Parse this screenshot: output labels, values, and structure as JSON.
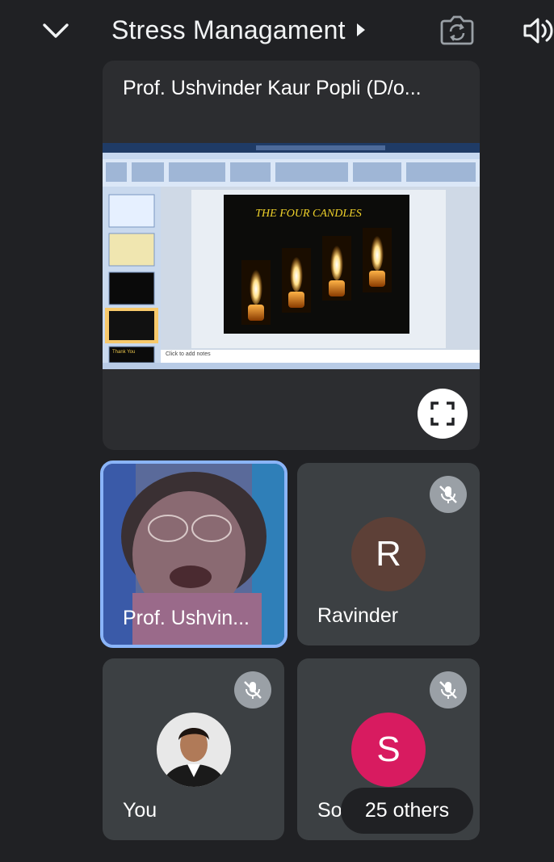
{
  "header": {
    "meeting_title": "Stress Managament",
    "collapse_icon": "chevron-down-icon",
    "switch_camera_icon": "camera-switch-icon",
    "audio_icon": "speaker-icon"
  },
  "presentation": {
    "presenter_label": "Prof. Ushvinder Kaur Popli (D/o...",
    "slide_title": "THE FOUR CANDLES",
    "notes_placeholder": "Click to add notes",
    "slide_thumbnail_text": "Thank You",
    "fullscreen_icon": "fullscreen-icon"
  },
  "participants": [
    {
      "name": "Prof. Ushvin...",
      "type": "video",
      "muted": false,
      "active_speaker": true
    },
    {
      "name": "Ravinder",
      "initial": "R",
      "avatar_color": "#5d4037",
      "muted": true
    },
    {
      "name": "You",
      "type": "photo",
      "muted": true
    },
    {
      "name": "So",
      "initial": "S",
      "avatar_color": "#d81b60",
      "muted": true
    }
  ],
  "others_count_label": "25 others",
  "colors": {
    "background": "#202124",
    "tile": "#3c4043",
    "active_border": "#8ab4f8"
  }
}
